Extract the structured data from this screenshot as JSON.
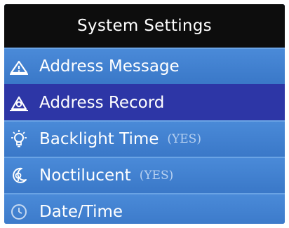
{
  "header": {
    "title": "System Settings"
  },
  "menu": {
    "items": [
      {
        "label": "Address Message",
        "icon": "address-message-icon"
      },
      {
        "label": "Address Record",
        "icon": "address-record-icon",
        "selected": true
      },
      {
        "label": "Backlight Time",
        "status": "(YES)",
        "icon": "lightbulb-icon"
      },
      {
        "label": "Noctilucent",
        "status": "(YES)",
        "icon": "noctilucent-icon"
      },
      {
        "label": "Date/Time",
        "icon": "clock-icon"
      }
    ]
  },
  "colors": {
    "title_background": "#0d0d0d",
    "item_background": "#3e7fcf",
    "selected_background": "#2d36a6",
    "text": "#ffffff",
    "status_text": "#b6d0f0"
  }
}
